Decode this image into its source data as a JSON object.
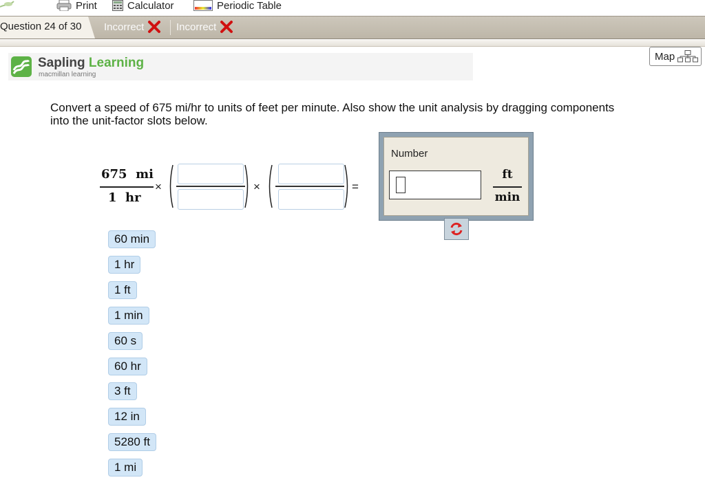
{
  "toolbar": {
    "print": "Print",
    "calculator": "Calculator",
    "periodic_table": "Periodic Table"
  },
  "question_bar": {
    "position": "Question 24 of 30",
    "attempts": [
      "Incorrect",
      "Incorrect"
    ]
  },
  "brand": {
    "name_part1": "Sapling",
    "name_part2": "Learning",
    "subtitle": "macmillan learning"
  },
  "map_button": {
    "label": "Map"
  },
  "question": {
    "text": "Convert a speed of 675 mi/hr to units of feet per minute. Also show the unit analysis by dragging components into the unit-factor slots below."
  },
  "equation": {
    "given_numerator": "675  mi",
    "given_denominator": "1  hr",
    "times": "×",
    "equals": "="
  },
  "answer": {
    "label": "Number",
    "value": "",
    "unit_numerator": "ft",
    "unit_denominator": "min"
  },
  "tiles": [
    "60 min",
    "1 hr",
    "1 ft",
    "1 min",
    "60 s",
    "60 hr",
    "3 ft",
    "12 in",
    "5280 ft",
    "1 mi"
  ],
  "colors": {
    "brand_green": "#5db246",
    "incorrect_red": "#d01010",
    "tile_bg": "#d2e6f7",
    "answer_frame": "#8fa2b1"
  }
}
